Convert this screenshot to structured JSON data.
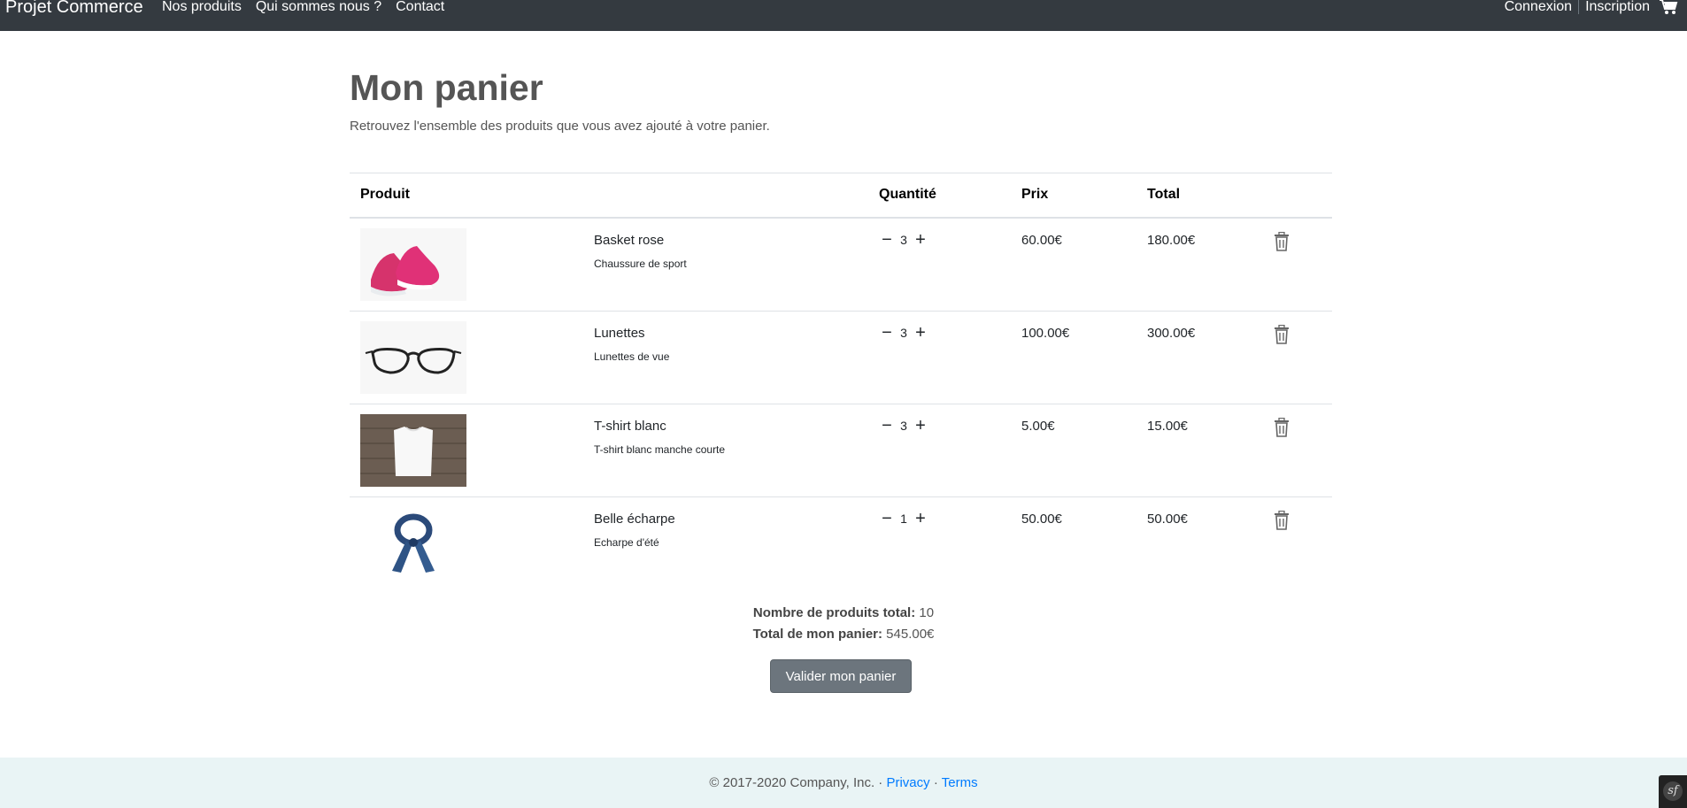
{
  "nav": {
    "brand": "Projet Commerce",
    "links": [
      "Nos produits",
      "Qui sommes nous ?",
      "Contact"
    ],
    "login": "Connexion",
    "register": "Inscription",
    "cart_icon": "cart-icon"
  },
  "page": {
    "title": "Mon panier",
    "subtitle": "Retrouvez l'ensemble des produits que vous avez ajouté à votre panier."
  },
  "table": {
    "headers": {
      "product": "Produit",
      "quantity": "Quantité",
      "price": "Prix",
      "total": "Total"
    },
    "rows": [
      {
        "name": "Basket rose",
        "desc": "Chaussure de sport",
        "qty": "3",
        "price": "60.00€",
        "total": "180.00€",
        "image": "pink-sneakers"
      },
      {
        "name": "Lunettes",
        "desc": "Lunettes de vue",
        "qty": "3",
        "price": "100.00€",
        "total": "300.00€",
        "image": "glasses"
      },
      {
        "name": "T-shirt blanc",
        "desc": "T-shirt blanc manche courte",
        "qty": "3",
        "price": "5.00€",
        "total": "15.00€",
        "image": "white-tshirt"
      },
      {
        "name": "Belle écharpe",
        "desc": "Echarpe d'été",
        "qty": "1",
        "price": "50.00€",
        "total": "50.00€",
        "image": "scarf"
      }
    ],
    "minus": "−",
    "plus": "+"
  },
  "summary": {
    "count_label": "Nombre de produits total:",
    "count_value": "10",
    "total_label": "Total de mon panier:",
    "total_value": "545.00€",
    "button": "Valider mon panier"
  },
  "footer": {
    "copyright": "© 2017-2020 Company, Inc. ·",
    "privacy": "Privacy",
    "dot": "·",
    "terms": "Terms",
    "badge": "sf"
  }
}
